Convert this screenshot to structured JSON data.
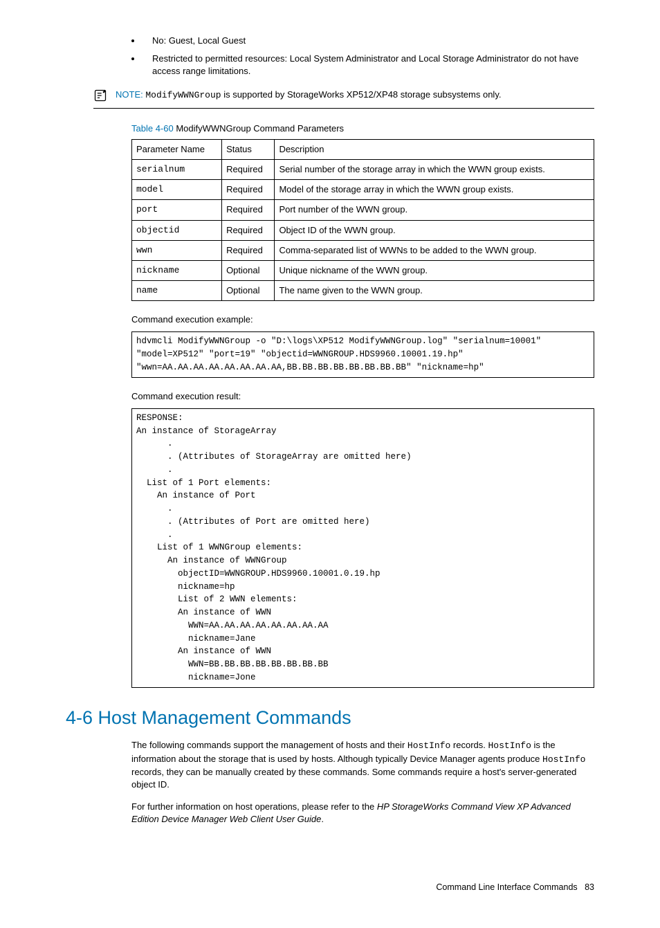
{
  "bullets": [
    "No: Guest, Local Guest",
    "Restricted to permitted resources: Local System Administrator and Local Storage Administrator do not have access range limitations."
  ],
  "note": {
    "label": "NOTE:",
    "code": "ModifyWWNGroup",
    "rest": " is supported by StorageWorks XP512/XP48 storage subsystems only."
  },
  "table": {
    "caption_num": "Table 4-60",
    "caption_text": "  ModifyWWNGroup Command Parameters",
    "headers": [
      "Parameter Name",
      "Status",
      "Description"
    ],
    "rows": [
      {
        "p": "serialnum",
        "s": "Required",
        "d": "Serial number of the storage array in which the WWN group exists."
      },
      {
        "p": "model",
        "s": "Required",
        "d": "Model of the storage array in which the WWN group exists."
      },
      {
        "p": "port",
        "s": "Required",
        "d": "Port number of the WWN group."
      },
      {
        "p": "objectid",
        "s": "Required",
        "d": "Object ID of the WWN group."
      },
      {
        "p": "wwn",
        "s": "Required",
        "d": "Comma-separated list of WWNs to be added to the WWN group."
      },
      {
        "p": "nickname",
        "s": "Optional",
        "d": "Unique nickname of the WWN group."
      },
      {
        "p": "name",
        "s": "Optional",
        "d": "The name given to the WWN group."
      }
    ]
  },
  "exec_example_label": "Command execution example:",
  "exec_example_code": "hdvmcli ModifyWWNGroup -o \"D:\\logs\\XP512 ModifyWWNGroup.log\" \"serialnum=10001\"\n\"model=XP512\" \"port=19\" \"objectid=WWNGROUP.HDS9960.10001.19.hp\"\n\"wwn=AA.AA.AA.AA.AA.AA.AA.AA,BB.BB.BB.BB.BB.BB.BB.BB\" \"nickname=hp\"",
  "exec_result_label": "Command execution result:",
  "exec_result_code": "RESPONSE:\nAn instance of StorageArray\n      .\n      . (Attributes of StorageArray are omitted here)\n      .\n  List of 1 Port elements:\n    An instance of Port\n      .\n      . (Attributes of Port are omitted here)\n      .\n    List of 1 WWNGroup elements:\n      An instance of WWNGroup\n        objectID=WWNGROUP.HDS9960.10001.0.19.hp\n        nickname=hp\n        List of 2 WWN elements:\n        An instance of WWN\n          WWN=AA.AA.AA.AA.AA.AA.AA.AA\n          nickname=Jane\n        An instance of WWN\n          WWN=BB.BB.BB.BB.BB.BB.BB.BB\n          nickname=Jone",
  "section_heading": "4-6 Host Management Commands",
  "para1": {
    "t1": "The following commands support the management of hosts and their ",
    "c1": "HostInfo",
    "t2": " records. ",
    "c2": "HostInfo",
    "t3": " is the information about the storage that is used by hosts. Although typically Device Manager agents produce ",
    "c3": "HostInfo",
    "t4": " records, they can be manually created by these commands. Some commands require a host's server-generated object ID."
  },
  "para2": {
    "t1": "For further information on host operations, please refer to the ",
    "i1": "HP StorageWorks Command View XP Advanced Edition Device Manager Web Client User Guide",
    "t2": "."
  },
  "footer": {
    "text": "Command Line Interface Commands",
    "page": "83"
  }
}
